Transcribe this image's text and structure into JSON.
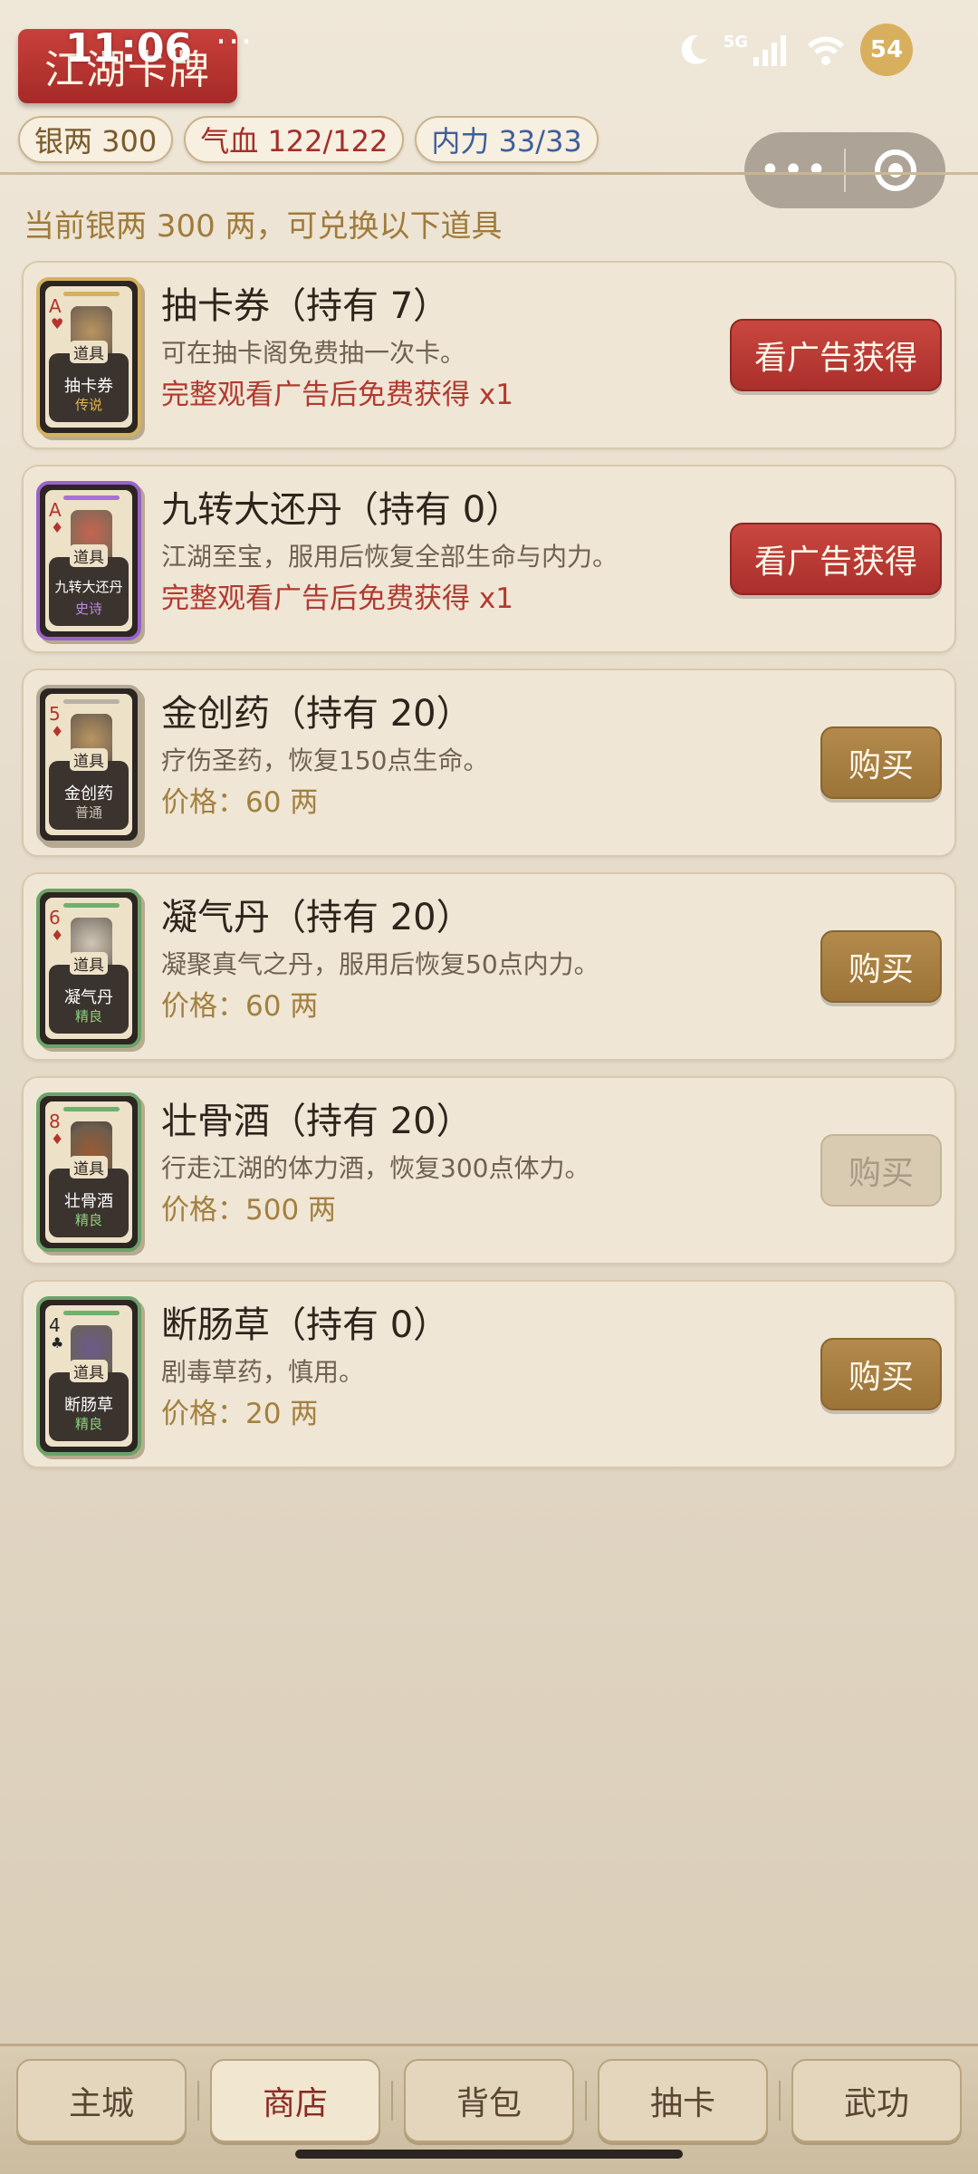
{
  "status_bar": {
    "time": "11:06",
    "network": "5G",
    "battery": "54"
  },
  "app_title": "江湖卡牌",
  "stats": {
    "silver": "银两 300",
    "hp": "气血 122/122",
    "mp": "内力 33/33"
  },
  "summary": "当前银两 300 两，可兑换以下道具",
  "items": [
    {
      "title": "抽卡券（持有 7）",
      "desc": "可在抽卡阁免费抽一次卡。",
      "line3": "完整观看广告后免费获得 x1",
      "button": "看广告获得",
      "card": {
        "rank": "A",
        "suit": "♥",
        "tag": "道具",
        "name": "抽卡券",
        "rarity": "传说"
      }
    },
    {
      "title": "九转大还丹（持有 0）",
      "desc": "江湖至宝，服用后恢复全部生命与内力。",
      "line3": "完整观看广告后免费获得 x1",
      "button": "看广告获得",
      "card": {
        "rank": "A",
        "suit": "♦",
        "tag": "道具",
        "name": "九转大还丹",
        "rarity": "史诗"
      }
    },
    {
      "title": "金创药（持有 20）",
      "desc": "疗伤圣药，恢复150点生命。",
      "line3": "价格：60 两",
      "button": "购买",
      "card": {
        "rank": "5",
        "suit": "♦",
        "tag": "道具",
        "name": "金创药",
        "rarity": "普通"
      }
    },
    {
      "title": "凝气丹（持有 20）",
      "desc": "凝聚真气之丹，服用后恢复50点内力。",
      "line3": "价格：60 两",
      "button": "购买",
      "card": {
        "rank": "6",
        "suit": "♦",
        "tag": "道具",
        "name": "凝气丹",
        "rarity": "精良"
      }
    },
    {
      "title": "壮骨酒（持有 20）",
      "desc": "行走江湖的体力酒，恢复300点体力。",
      "line3": "价格：500 两",
      "button": "购买",
      "card": {
        "rank": "8",
        "suit": "♦",
        "tag": "道具",
        "name": "壮骨酒",
        "rarity": "精良"
      }
    },
    {
      "title": "断肠草（持有 0）",
      "desc": "剧毒草药，慎用。",
      "line3": "价格：20 两",
      "button": "购买",
      "card": {
        "rank": "4",
        "suit": "♣",
        "tag": "道具",
        "name": "断肠草",
        "rarity": "精良"
      }
    }
  ],
  "nav": [
    "主城",
    "商店",
    "背包",
    "抽卡",
    "武功"
  ],
  "nav_active": "商店",
  "colors": {
    "accent_red": "#ab2f2b",
    "buy_gold": "#9c7438",
    "legend": "#e0b94f",
    "epic": "#a772d1",
    "fine": "#6fb06c"
  }
}
